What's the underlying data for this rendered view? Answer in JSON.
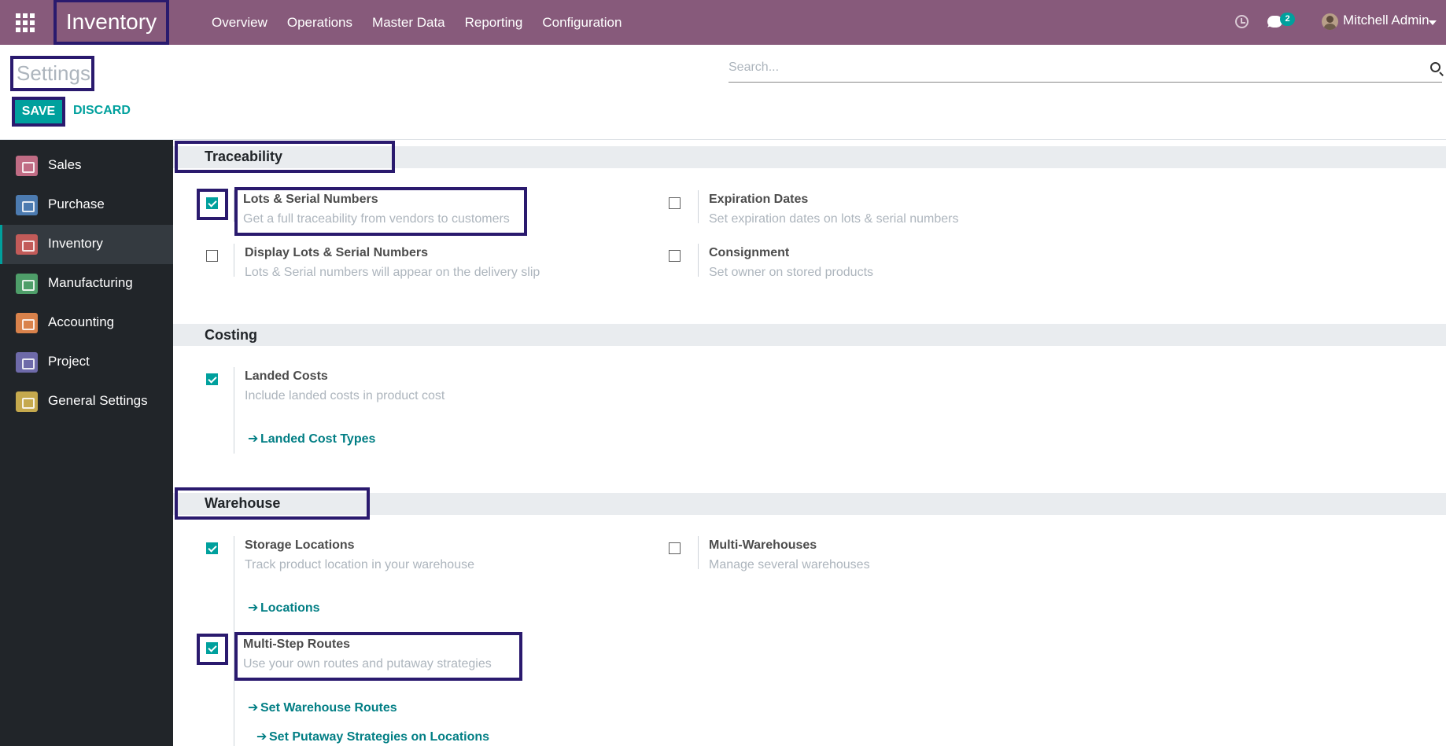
{
  "topbar": {
    "app_title": "Inventory",
    "menu": [
      "Overview",
      "Operations",
      "Master Data",
      "Reporting",
      "Configuration"
    ],
    "message_count": "2",
    "user_name": "Mitchell Admin"
  },
  "control_panel": {
    "title": "Settings",
    "search_placeholder": "Search...",
    "save_label": "SAVE",
    "discard_label": "DISCARD"
  },
  "sidebar": {
    "items": [
      {
        "label": "Sales",
        "icon": "sales-icon",
        "color": "#c06c84"
      },
      {
        "label": "Purchase",
        "icon": "purchase-icon",
        "color": "#4c7bb0"
      },
      {
        "label": "Inventory",
        "icon": "inventory-icon",
        "color": "#c25b59"
      },
      {
        "label": "Manufacturing",
        "icon": "manufacturing-icon",
        "color": "#4e9e69"
      },
      {
        "label": "Accounting",
        "icon": "accounting-icon",
        "color": "#d9824b"
      },
      {
        "label": "Project",
        "icon": "project-icon",
        "color": "#6e6aa9"
      },
      {
        "label": "General Settings",
        "icon": "gear-icon",
        "color": "#c5a94d"
      }
    ]
  },
  "sections": {
    "traceability": {
      "title": "Traceability",
      "options": [
        {
          "title": "Lots & Serial Numbers",
          "desc": "Get a full traceability from vendors to customers",
          "checked": true
        },
        {
          "title": "Expiration Dates",
          "desc": "Set expiration dates on lots & serial numbers",
          "checked": false
        },
        {
          "title": "Display Lots & Serial Numbers",
          "desc": "Lots & Serial numbers will appear on the delivery slip",
          "checked": false
        },
        {
          "title": "Consignment",
          "desc": "Set owner on stored products",
          "checked": false
        }
      ]
    },
    "costing": {
      "title": "Costing",
      "options": [
        {
          "title": "Landed Costs",
          "desc": "Include landed costs in product cost",
          "checked": true,
          "link": "Landed Cost Types"
        }
      ]
    },
    "warehouse": {
      "title": "Warehouse",
      "options": [
        {
          "title": "Storage Locations",
          "desc": "Track product location in your warehouse",
          "checked": true,
          "link": "Locations"
        },
        {
          "title": "Multi-Warehouses",
          "desc": "Manage several warehouses",
          "checked": false
        },
        {
          "title": "Multi-Step Routes",
          "desc": "Use your own routes and putaway strategies",
          "checked": true,
          "links": [
            "Set Warehouse Routes",
            "Set Putaway Strategies on Locations"
          ]
        }
      ]
    }
  },
  "colors": {
    "brand": "#875a7b",
    "accent": "#00a09d",
    "highlight": "#2a1a6e"
  }
}
